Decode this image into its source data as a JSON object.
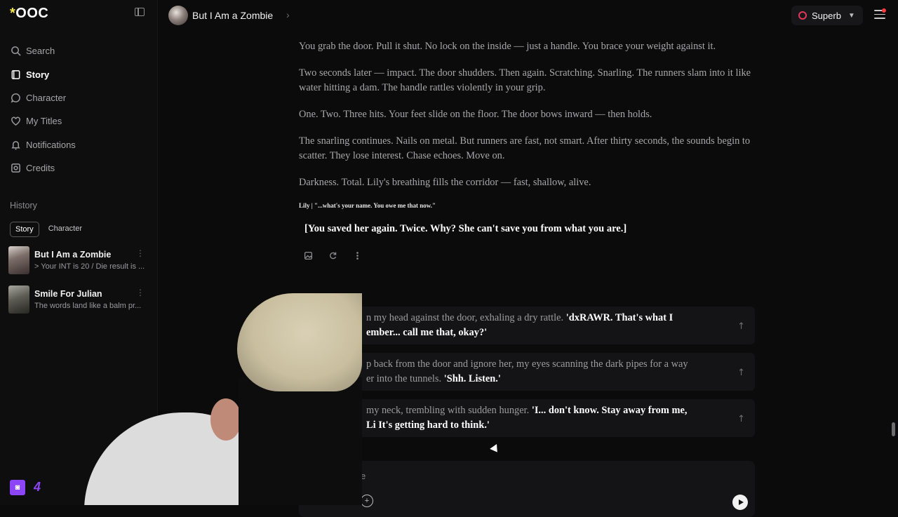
{
  "sidebar": {
    "logo": "OOC",
    "nav": [
      {
        "label": "Search",
        "icon": "search-icon"
      },
      {
        "label": "Story",
        "icon": "book-icon",
        "active": true
      },
      {
        "label": "Character",
        "icon": "chat-icon"
      },
      {
        "label": "My Titles",
        "icon": "heart-icon"
      },
      {
        "label": "Notifications",
        "icon": "bell-icon"
      },
      {
        "label": "Credits",
        "icon": "credits-icon"
      }
    ],
    "history_title": "History",
    "history_tabs": [
      "Story",
      "Character"
    ],
    "history": [
      {
        "title": "But I Am a Zombie",
        "snippet": "> Your INT is 20 / Die result is ..."
      },
      {
        "title": "Smile For Julian",
        "snippet": "The words land like a balm pr..."
      }
    ],
    "twitch_count": "4"
  },
  "topbar": {
    "story_title": "But I Am a Zombie",
    "model": "Superb"
  },
  "story": {
    "paragraphs": [
      "You grab the door. Pull it shut. No lock on the inside — just a handle. You brace your weight against it.",
      "Two seconds later — impact. The door shudders. Then again. Scratching. Snarling. The runners slam into it like water hitting a dam. The handle rattles violently in your grip.",
      "One. Two. Three hits. Your feet slide on the floor. The door bows inward — then holds.",
      "The snarling continues. Nails on metal. But runners are fast, not smart. After thirty seconds, the sounds begin to scatter. They lose interest. Chase echoes. Move on.",
      "Darkness. Total. Lily's breathing fills the corridor — fast, shallow, alive."
    ],
    "lily_line": "Lily | \"...what's your name. You owe me that now.\"",
    "system_line": "[You saved her again. Twice. Why? She can't save you from what you are.]"
  },
  "choices": [
    {
      "action": "n my head against the door, exhaling a dry rattle.",
      "speech": "'dxRAWR. That's what I",
      "speech2": "ember... call me that, okay?'"
    },
    {
      "action": "p back from the door and ignore her, my eyes scanning the dark pipes for a way",
      "action2": "er into the tunnels.",
      "speech": "'Shh. Listen.'"
    },
    {
      "action": "my neck, trembling with sudden hunger.",
      "speech": "'I... don't know. Stay away from me,",
      "speech2": "Li  It's getting hard to think.'"
    }
  ],
  "composer": {
    "placeholder": "e"
  }
}
